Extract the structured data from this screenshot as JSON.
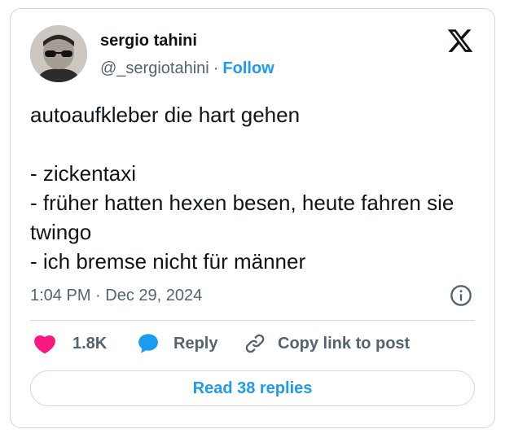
{
  "author": {
    "name": "sergio tahini",
    "handle": "@_sergiotahini",
    "separator": "·",
    "follow_label": "Follow"
  },
  "tweet": {
    "text": "autoaufkleber die hart gehen\n\n- zickentaxi\n- früher hatten hexen besen, heute fahren sie twingo\n- ich bremse nicht für männer",
    "timestamp": "1:04 PM · Dec 29, 2024"
  },
  "actions": {
    "like_count": "1.8K",
    "reply_label": "Reply",
    "copy_link_label": "Copy link to post"
  },
  "read_replies_label": "Read 38 replies",
  "icons": {
    "platform": "x-logo-icon",
    "info": "info-icon",
    "like": "heart-icon",
    "reply": "speech-bubble-icon",
    "copy_link": "link-icon"
  },
  "colors": {
    "accent": "#1d9bf0",
    "like": "#f91880",
    "secondary_text": "#536471",
    "primary_text": "#0f1419",
    "border": "#cfd9de"
  }
}
